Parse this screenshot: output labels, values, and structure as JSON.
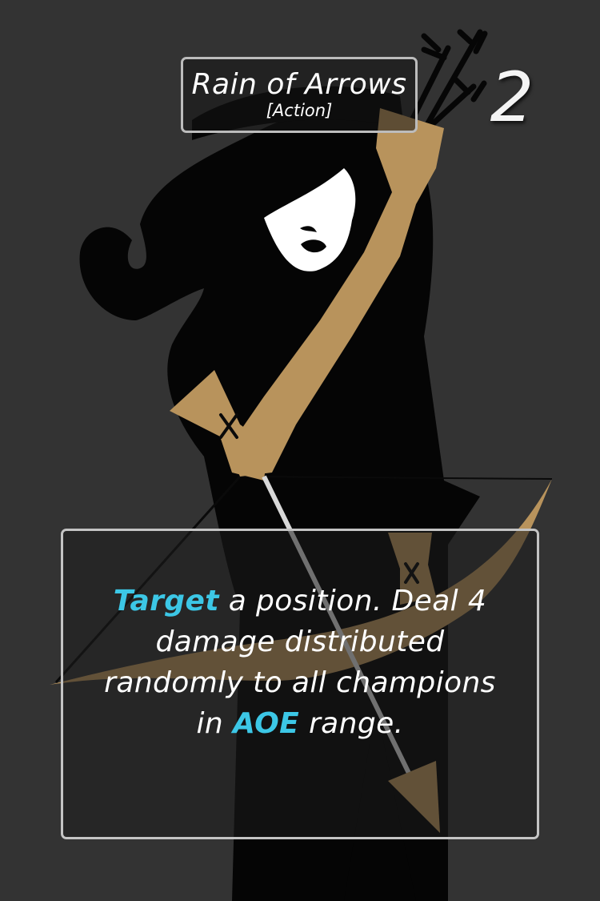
{
  "card": {
    "name": "Rain of Arrows",
    "type": "[Action]",
    "cost": "2",
    "ability": {
      "keyword_1": "Target",
      "text_1": " a position.  Deal 4 damage distributed randomly to all champions in ",
      "keyword_2": "AOE",
      "text_2": " range."
    }
  },
  "colors": {
    "background": "#333333",
    "silhouette": "#050505",
    "bow_gold": "#b8935c",
    "keyword": "#3cc7e6",
    "frame": "#c4c4c4"
  }
}
